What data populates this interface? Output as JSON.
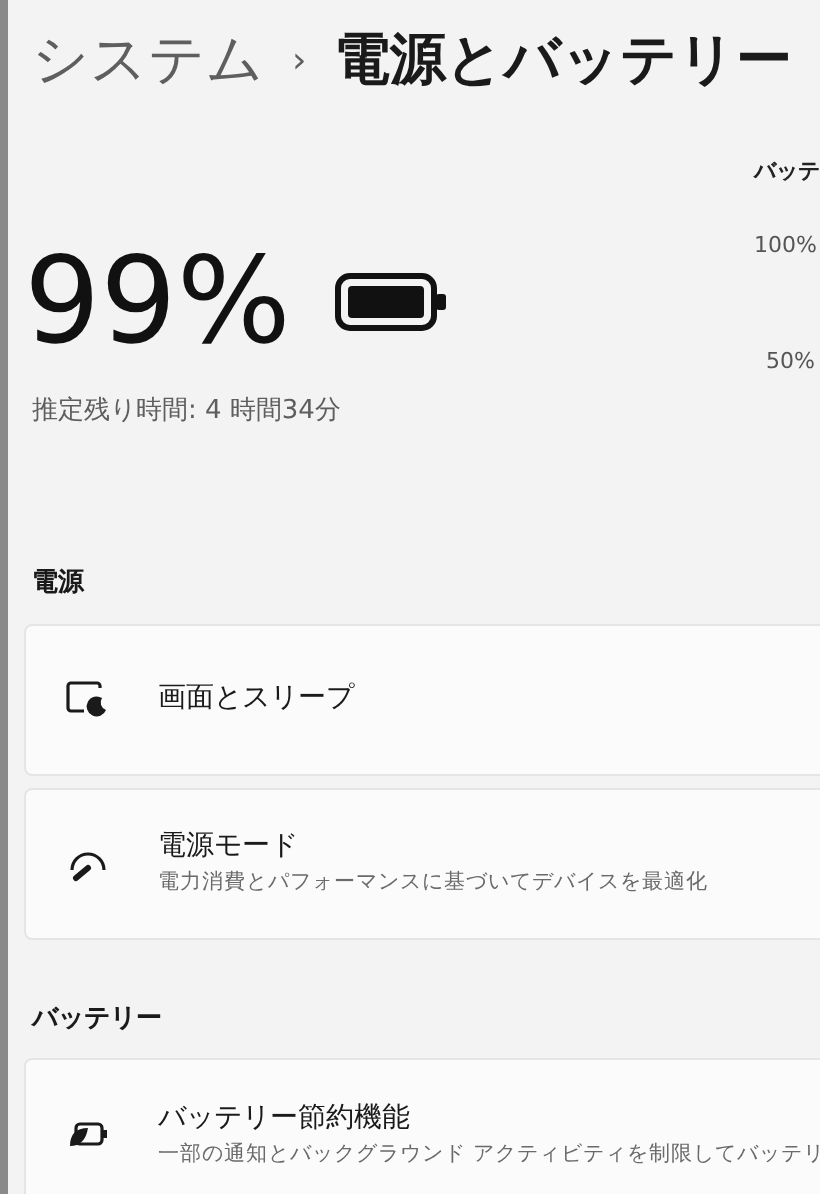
{
  "breadcrumb": {
    "parent": "システム",
    "separator": "›",
    "current": "電源とバッテリー"
  },
  "battery": {
    "percent": "99%",
    "estimate": "推定残り時間: 4 時間34分"
  },
  "usage_chart": {
    "title": "バッテ",
    "ticks": [
      "100%",
      "50%"
    ]
  },
  "sections": [
    {
      "heading": "電源",
      "items": [
        {
          "kind": "monitor-moon",
          "title": "画面とスリープ"
        },
        {
          "kind": "gauge",
          "title": "電源モード",
          "subtitle": "電力消費とパフォーマンスに基づいてデバイスを最適化"
        }
      ]
    },
    {
      "heading": "バッテリー",
      "items": [
        {
          "kind": "battery-leaf",
          "title": "バッテリー節約機能",
          "subtitle": "一部の通知とバックグラウンド アクティビティを制限してバッテリ"
        }
      ]
    }
  ]
}
